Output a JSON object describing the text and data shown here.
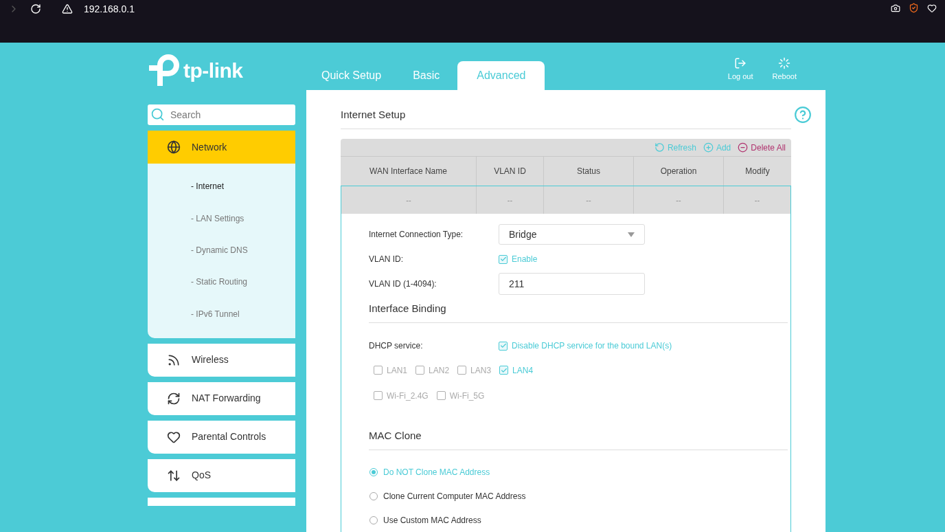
{
  "browser": {
    "url": "192.168.0.1"
  },
  "logo": {
    "text": "tp-link"
  },
  "tabs": [
    {
      "label": "Quick Setup",
      "selected": false
    },
    {
      "label": "Basic",
      "selected": false
    },
    {
      "label": "Advanced",
      "selected": true
    }
  ],
  "header_actions": [
    {
      "kind": "logout",
      "label": "Log out"
    },
    {
      "kind": "reboot",
      "label": "Reboot"
    }
  ],
  "sidebar": {
    "search": {
      "placeholder": "Search"
    },
    "items": [
      {
        "label": "Network",
        "kind": "globe",
        "expanded": true,
        "children": [
          {
            "label": "- Internet",
            "selected": true
          },
          {
            "label": "- LAN Settings",
            "selected": false
          },
          {
            "label": "- Dynamic DNS",
            "selected": false
          },
          {
            "label": "- Static Routing",
            "selected": false
          },
          {
            "label": "- IPv6 Tunnel",
            "selected": false
          }
        ]
      },
      {
        "label": "Wireless",
        "kind": "wifi",
        "expanded": false
      },
      {
        "label": "NAT Forwarding",
        "kind": "cycle",
        "expanded": false
      },
      {
        "label": "Parental Controls",
        "kind": "heart",
        "expanded": false
      },
      {
        "label": "QoS",
        "kind": "updown",
        "expanded": false
      }
    ]
  },
  "page": {
    "title": "Internet Setup",
    "toolbar": [
      {
        "kind": "refresh",
        "label": "Refresh"
      },
      {
        "kind": "add",
        "label": "Add"
      },
      {
        "kind": "delete",
        "label": "Delete All"
      }
    ],
    "table": {
      "columns": [
        "WAN Interface Name",
        "VLAN ID",
        "Status",
        "Operation",
        "Modify"
      ],
      "rows": [
        [
          "--",
          "--",
          "--",
          "--",
          "--"
        ]
      ]
    },
    "form": [
      {
        "kind": "select",
        "label": "Internet Connection Type:",
        "value": "Bridge"
      },
      {
        "kind": "checkbox",
        "label": "VLAN ID:",
        "option": "Enable",
        "checked": true
      },
      {
        "kind": "input",
        "label": "VLAN ID (1-4094):",
        "value": "211"
      }
    ],
    "binding": {
      "title": "Interface Binding",
      "dhcp_label": "DHCP service:",
      "dhcp_option": "Disable DHCP service for the bound LAN(s)",
      "dhcp_checked": true,
      "ports": [
        [
          {
            "label": "LAN1",
            "checked": false
          },
          {
            "label": "LAN2",
            "checked": false
          },
          {
            "label": "LAN3",
            "checked": false
          },
          {
            "label": "LAN4",
            "checked": true
          }
        ],
        [
          {
            "label": "Wi-Fi_2.4G",
            "checked": false
          },
          {
            "label": "Wi-Fi_5G",
            "checked": false
          }
        ]
      ]
    },
    "mac_clone": {
      "title": "MAC Clone",
      "options": [
        {
          "label": "Do NOT Clone MAC Address",
          "selected": true
        },
        {
          "label": "Clone Current Computer MAC Address",
          "selected": false
        },
        {
          "label": "Use Custom MAC Address",
          "selected": false
        }
      ]
    }
  }
}
